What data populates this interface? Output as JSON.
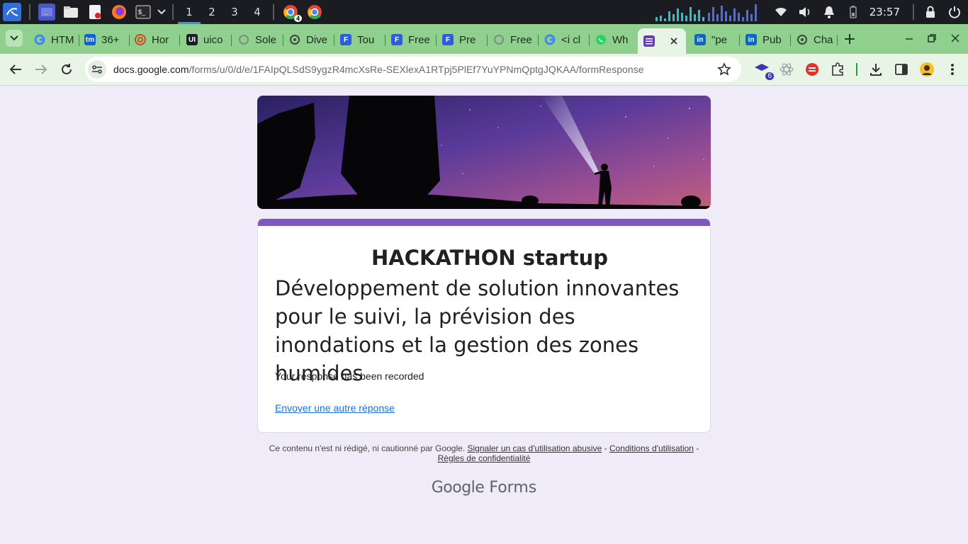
{
  "taskbar": {
    "workspaces": [
      "1",
      "2",
      "3",
      "4"
    ],
    "active_workspace": "1",
    "chrome_badge": "4",
    "clock": "23:57"
  },
  "tabs": [
    {
      "label": "HTM",
      "icon": "google-icon"
    },
    {
      "label": "36+",
      "icon": "tm-icon"
    },
    {
      "label": "Hor",
      "icon": "spiral-icon"
    },
    {
      "label": "uico",
      "icon": "ui-icon"
    },
    {
      "label": "Sole",
      "icon": "chatgpt-icon"
    },
    {
      "label": "Dive",
      "icon": "openai-icon"
    },
    {
      "label": "Tou",
      "icon": "f-icon"
    },
    {
      "label": "Free",
      "icon": "f-icon"
    },
    {
      "label": "Pre",
      "icon": "f-icon"
    },
    {
      "label": "Free",
      "icon": "chatgpt-icon"
    },
    {
      "label": "<i cl",
      "icon": "google-icon"
    },
    {
      "label": "Wh",
      "icon": "whatsapp-icon"
    },
    {
      "label": "",
      "icon": "forms-icon",
      "active": true
    },
    {
      "label": "\"pe",
      "icon": "linkedin-icon"
    },
    {
      "label": "Pub",
      "icon": "linkedin-icon"
    },
    {
      "label": "Cha",
      "icon": "openai-icon"
    }
  ],
  "omnibox": {
    "domain": "docs.google.com",
    "path": "/forms/u/0/d/e/1FAIpQLSdS9ygzR4mcXsRe-SEXlexA1RTpj5PlEf7YuYPNmQptgJQKAA/formResponse"
  },
  "extensions": {
    "badge": "6"
  },
  "form": {
    "title": "HACKATHON startup",
    "description": "Développement de solution innovantes pour le suivi, la prévision des inondations et la gestion des zones humides",
    "confirmation": "Your response has been recorded",
    "submit_another": "Envoyer une autre réponse"
  },
  "footer": {
    "disclaimer": "Ce contenu n'est ni rédigé, ni cautionné par Google.",
    "report_abuse": "Signaler un cas d'utilisation abusive",
    "terms": "Conditions d'utilisation",
    "privacy": "Règles de confidentialité",
    "dash": "-",
    "brand_google": "Google",
    "brand_forms": "Forms"
  },
  "colors": {
    "page_bg": "#f0ebf8",
    "theme": "#673ab7",
    "tabstrip": "#8fd08f",
    "link": "#1a73e8"
  }
}
